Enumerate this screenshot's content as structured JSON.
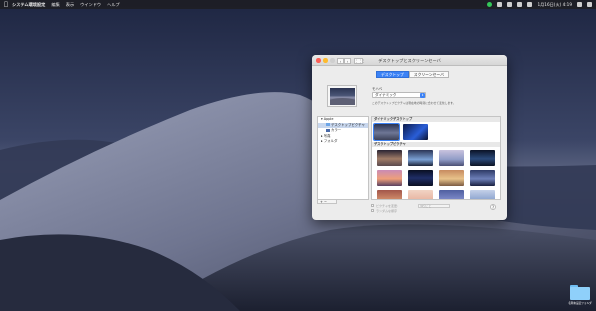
{
  "menubar": {
    "apple": "",
    "app": "システム環境設定",
    "menus": [
      "編集",
      "表示",
      "ウインドウ",
      "ヘルプ"
    ],
    "time": "1月16日(火) 4:19"
  },
  "window": {
    "title": "デスクトップとスクリーンセーバ",
    "nav_back": "‹",
    "nav_forward": "›",
    "grid_button": "⋮⋮⋮",
    "tabs": [
      "デスクトップ",
      "スクリーンセーバ"
    ],
    "active_tab": "デスクトップ",
    "picture_label": "モハベ",
    "mode_select": "ダイナミック",
    "mode_description": "このデスクトップピクチャは現在地の時刻に合わせて変化します。",
    "sidebar": {
      "apple_group": "Apple",
      "desktop_pictures": "デスクトップピクチャ",
      "colors": "カラー",
      "photos": "写真",
      "folders": "フォルダ"
    },
    "add_remove": "+ −",
    "dynamic_heading": "ダイナミックデスクトップ",
    "pictures_heading": "デスクトップピクチャ",
    "option_change": "ピクチャを変更:",
    "option_change_interval": "30分ごと",
    "option_random": "ランダムな順序",
    "help": "?"
  },
  "desktop": {
    "folder_label": "名称未設定フォルダ"
  }
}
